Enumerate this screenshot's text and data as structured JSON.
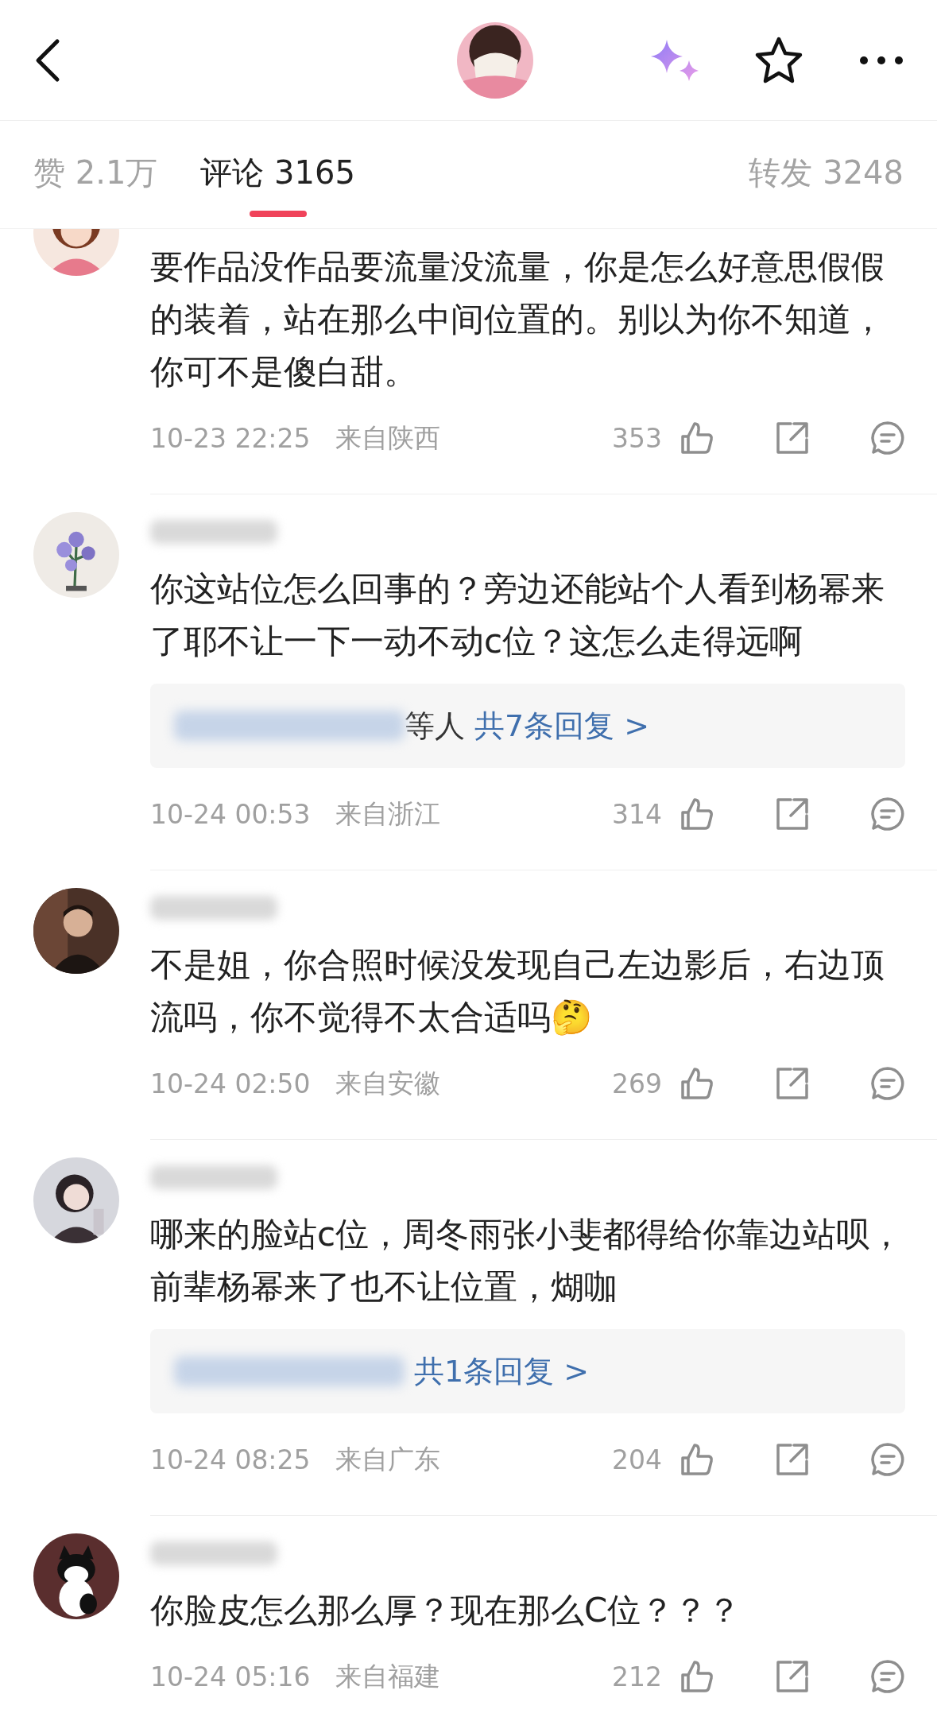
{
  "tabs": [
    {
      "label": "赞 2.1万",
      "selected": false
    },
    {
      "label": "评论 3165",
      "selected": true
    },
    {
      "label": "转发 3248",
      "selected": false
    }
  ],
  "comments": [
    {
      "text": "要作品没作品要流量没流量，你是怎么好意思假假的装着，站在那么中间位置的。别以为你不知道，你可不是傻白甜。",
      "time": "10-23 22:25",
      "location": "来自陕西",
      "likes": "353"
    },
    {
      "text": "你这站位怎么回事的？旁边还能站个人看到杨幂来了耶不让一下一动不动c位？这怎么走得远啊",
      "replies": {
        "suffix": "等人",
        "link": "共7条回复 >"
      },
      "time": "10-24 00:53",
      "location": "来自浙江",
      "likes": "314"
    },
    {
      "text": "不是姐，你合照时候没发现自己左边影后，右边顶流吗，你不觉得不太合适吗🤔",
      "time": "10-24 02:50",
      "location": "来自安徽",
      "likes": "269"
    },
    {
      "text": "哪来的脸站c位，周冬雨张小斐都得给你靠边站呗，前辈杨幂来了也不让位置，煳咖",
      "replies": {
        "link": "共1条回复 >"
      },
      "time": "10-24 08:25",
      "location": "来自广东",
      "likes": "204"
    },
    {
      "text": "你脸皮怎么那么厚？现在那么C位？？？",
      "time": "10-24 05:16",
      "location": "来自福建",
      "likes": "212"
    }
  ]
}
